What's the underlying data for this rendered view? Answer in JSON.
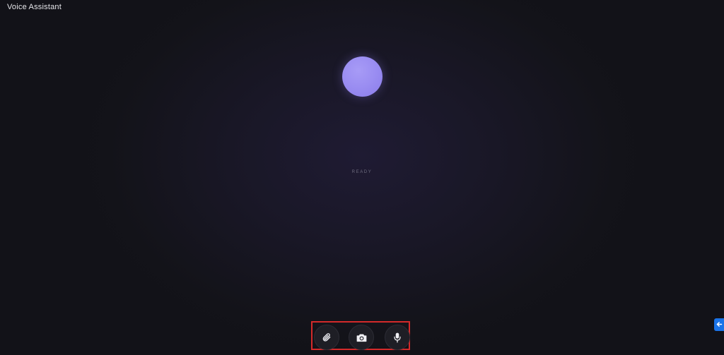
{
  "app": {
    "title": "Voice Assistant"
  },
  "assistant": {
    "status": "READY"
  },
  "controls": {
    "buttons": [
      {
        "name": "attach",
        "icon": "paperclip-icon"
      },
      {
        "name": "camera",
        "icon": "camera-icon"
      },
      {
        "name": "microphone",
        "icon": "microphone-icon"
      }
    ]
  },
  "side_tab": {
    "icon": "arrow-left-icon"
  },
  "colors": {
    "background": "#121218",
    "orb": "#9b8ef2",
    "highlight_border": "#d42a2a",
    "side_tab": "#1a73e8"
  }
}
